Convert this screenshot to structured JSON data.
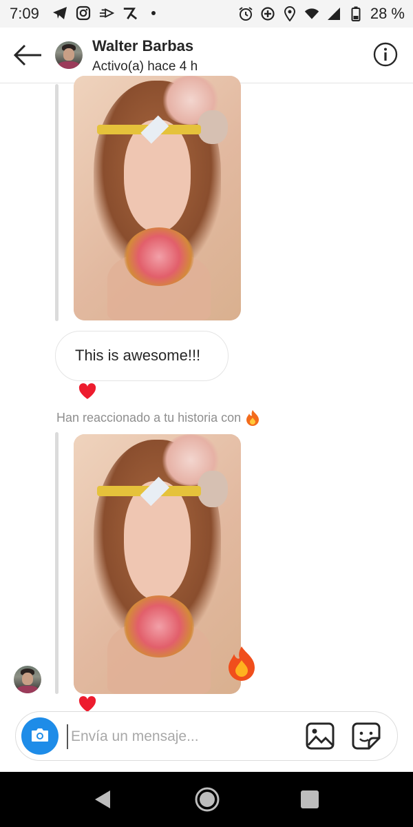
{
  "status_bar": {
    "time": "7:09",
    "left_icons": [
      "telegram-icon",
      "instagram-icon",
      "messenger-icon",
      "app-icon",
      "dot-icon"
    ],
    "right_icons": [
      "alarm-icon",
      "data-saver-icon",
      "location-icon",
      "wifi-icon",
      "signal-icon",
      "battery-icon"
    ],
    "battery": "28 %"
  },
  "header": {
    "name": "Walter Barbas",
    "status": "Activo(a) hace 4 h"
  },
  "messages": {
    "text_bubble": "This is awesome!!!",
    "reaction_note": "Han reaccionado a tu historia con"
  },
  "composer": {
    "placeholder": "Envía un mensaje..."
  },
  "colors": {
    "accent": "#1e8ce8",
    "heart": "#ed1c2e",
    "fire": "#f36b1c"
  }
}
